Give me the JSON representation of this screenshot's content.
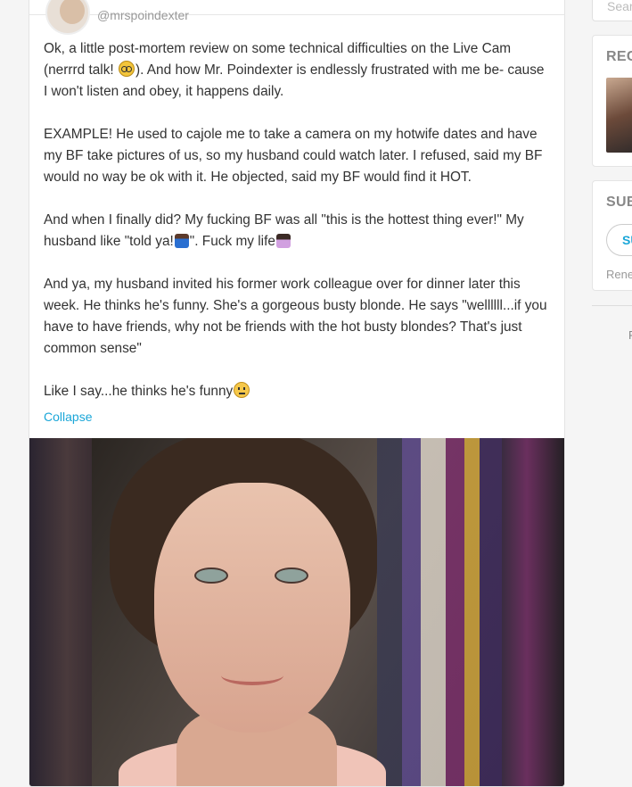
{
  "post": {
    "username": "@mrspoindexter",
    "paragraphs": [
      [
        "Ok, a little post-mortem review on some technical difficulties on the Live Cam (nerrrd talk! ",
        "). And how Mr. Poindexter is endlessly frustrated with me be- cause I won't listen and obey, it happens daily."
      ],
      [
        "EXAMPLE! He used to cajole me to take a camera on my hotwife dates and have my BF take pictures of us, so my husband could watch later. I refused, said my BF would no way be ok with it. He objected, said my BF would find it HOT."
      ],
      [
        "And when I finally did? My fucking BF was all \"this is the hottest thing ever!\" My husband like \"told ya!",
        "\". Fuck my life"
      ],
      [
        "And ya, my husband invited his former work colleague over for dinner later this week. He thinks he's funny. She's a gorgeous busty blonde. He says \"wellllll...if you have to have friends, why not be friends with the hot busty blondes? That's just common sense\""
      ],
      [
        "Like I say...he thinks he's funny"
      ]
    ],
    "emojis": [
      "nerd-face-glasses",
      "man-shrugging",
      "woman-facepalming",
      "neutral-face"
    ],
    "collapse_label": "Collapse"
  },
  "sidebar": {
    "search_placeholder": "Sear",
    "recent_title": "REC",
    "subscribe_title": "SUB",
    "subscribe_button": "SU",
    "renew_text": "Rene",
    "footer_char": "F"
  },
  "colors": {
    "link": "#1aa6d8",
    "text": "#333333",
    "muted": "#999999"
  }
}
